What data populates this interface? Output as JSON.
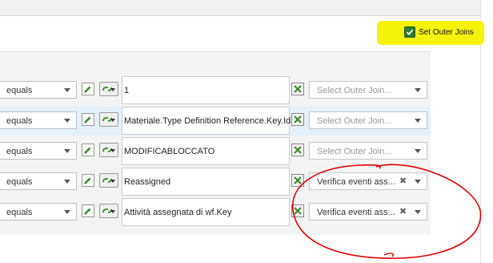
{
  "outer_joins": {
    "label": "Set Outer Joins",
    "checked": true
  },
  "rows": [
    {
      "operator": "equals",
      "value": "1",
      "outer_join": "Select Outer Join...",
      "selected": false
    },
    {
      "operator": "equals",
      "value": "Materiale.Type Definition Reference.Key.Id",
      "outer_join": "Select Outer Join...",
      "selected": false
    },
    {
      "operator": "equals",
      "value": "MODIFICABLOCCATO",
      "outer_join": "Select Outer Join...",
      "selected": false
    },
    {
      "operator": "equals",
      "value": "Reassigned",
      "outer_join": "Verifica eventi ass...",
      "selected": true
    },
    {
      "operator": "equals",
      "value": "Attività assegnata di wf.Key",
      "outer_join": "Verifica eventi ass...",
      "selected": true
    }
  ],
  "icons": {
    "edit": "pencil-icon",
    "link": "chain-link-icon",
    "remove": "delete-x-icon",
    "clear": "clear-x-icon",
    "dropdown": "chevron-down-icon",
    "check": "checkmark-icon"
  },
  "colors": {
    "highlight": "#f7f20b",
    "checkbox": "#2e7d32",
    "row_alt": "#e4f1fb",
    "annotation": "#e00000",
    "icon_green": "#3a8a2a"
  }
}
